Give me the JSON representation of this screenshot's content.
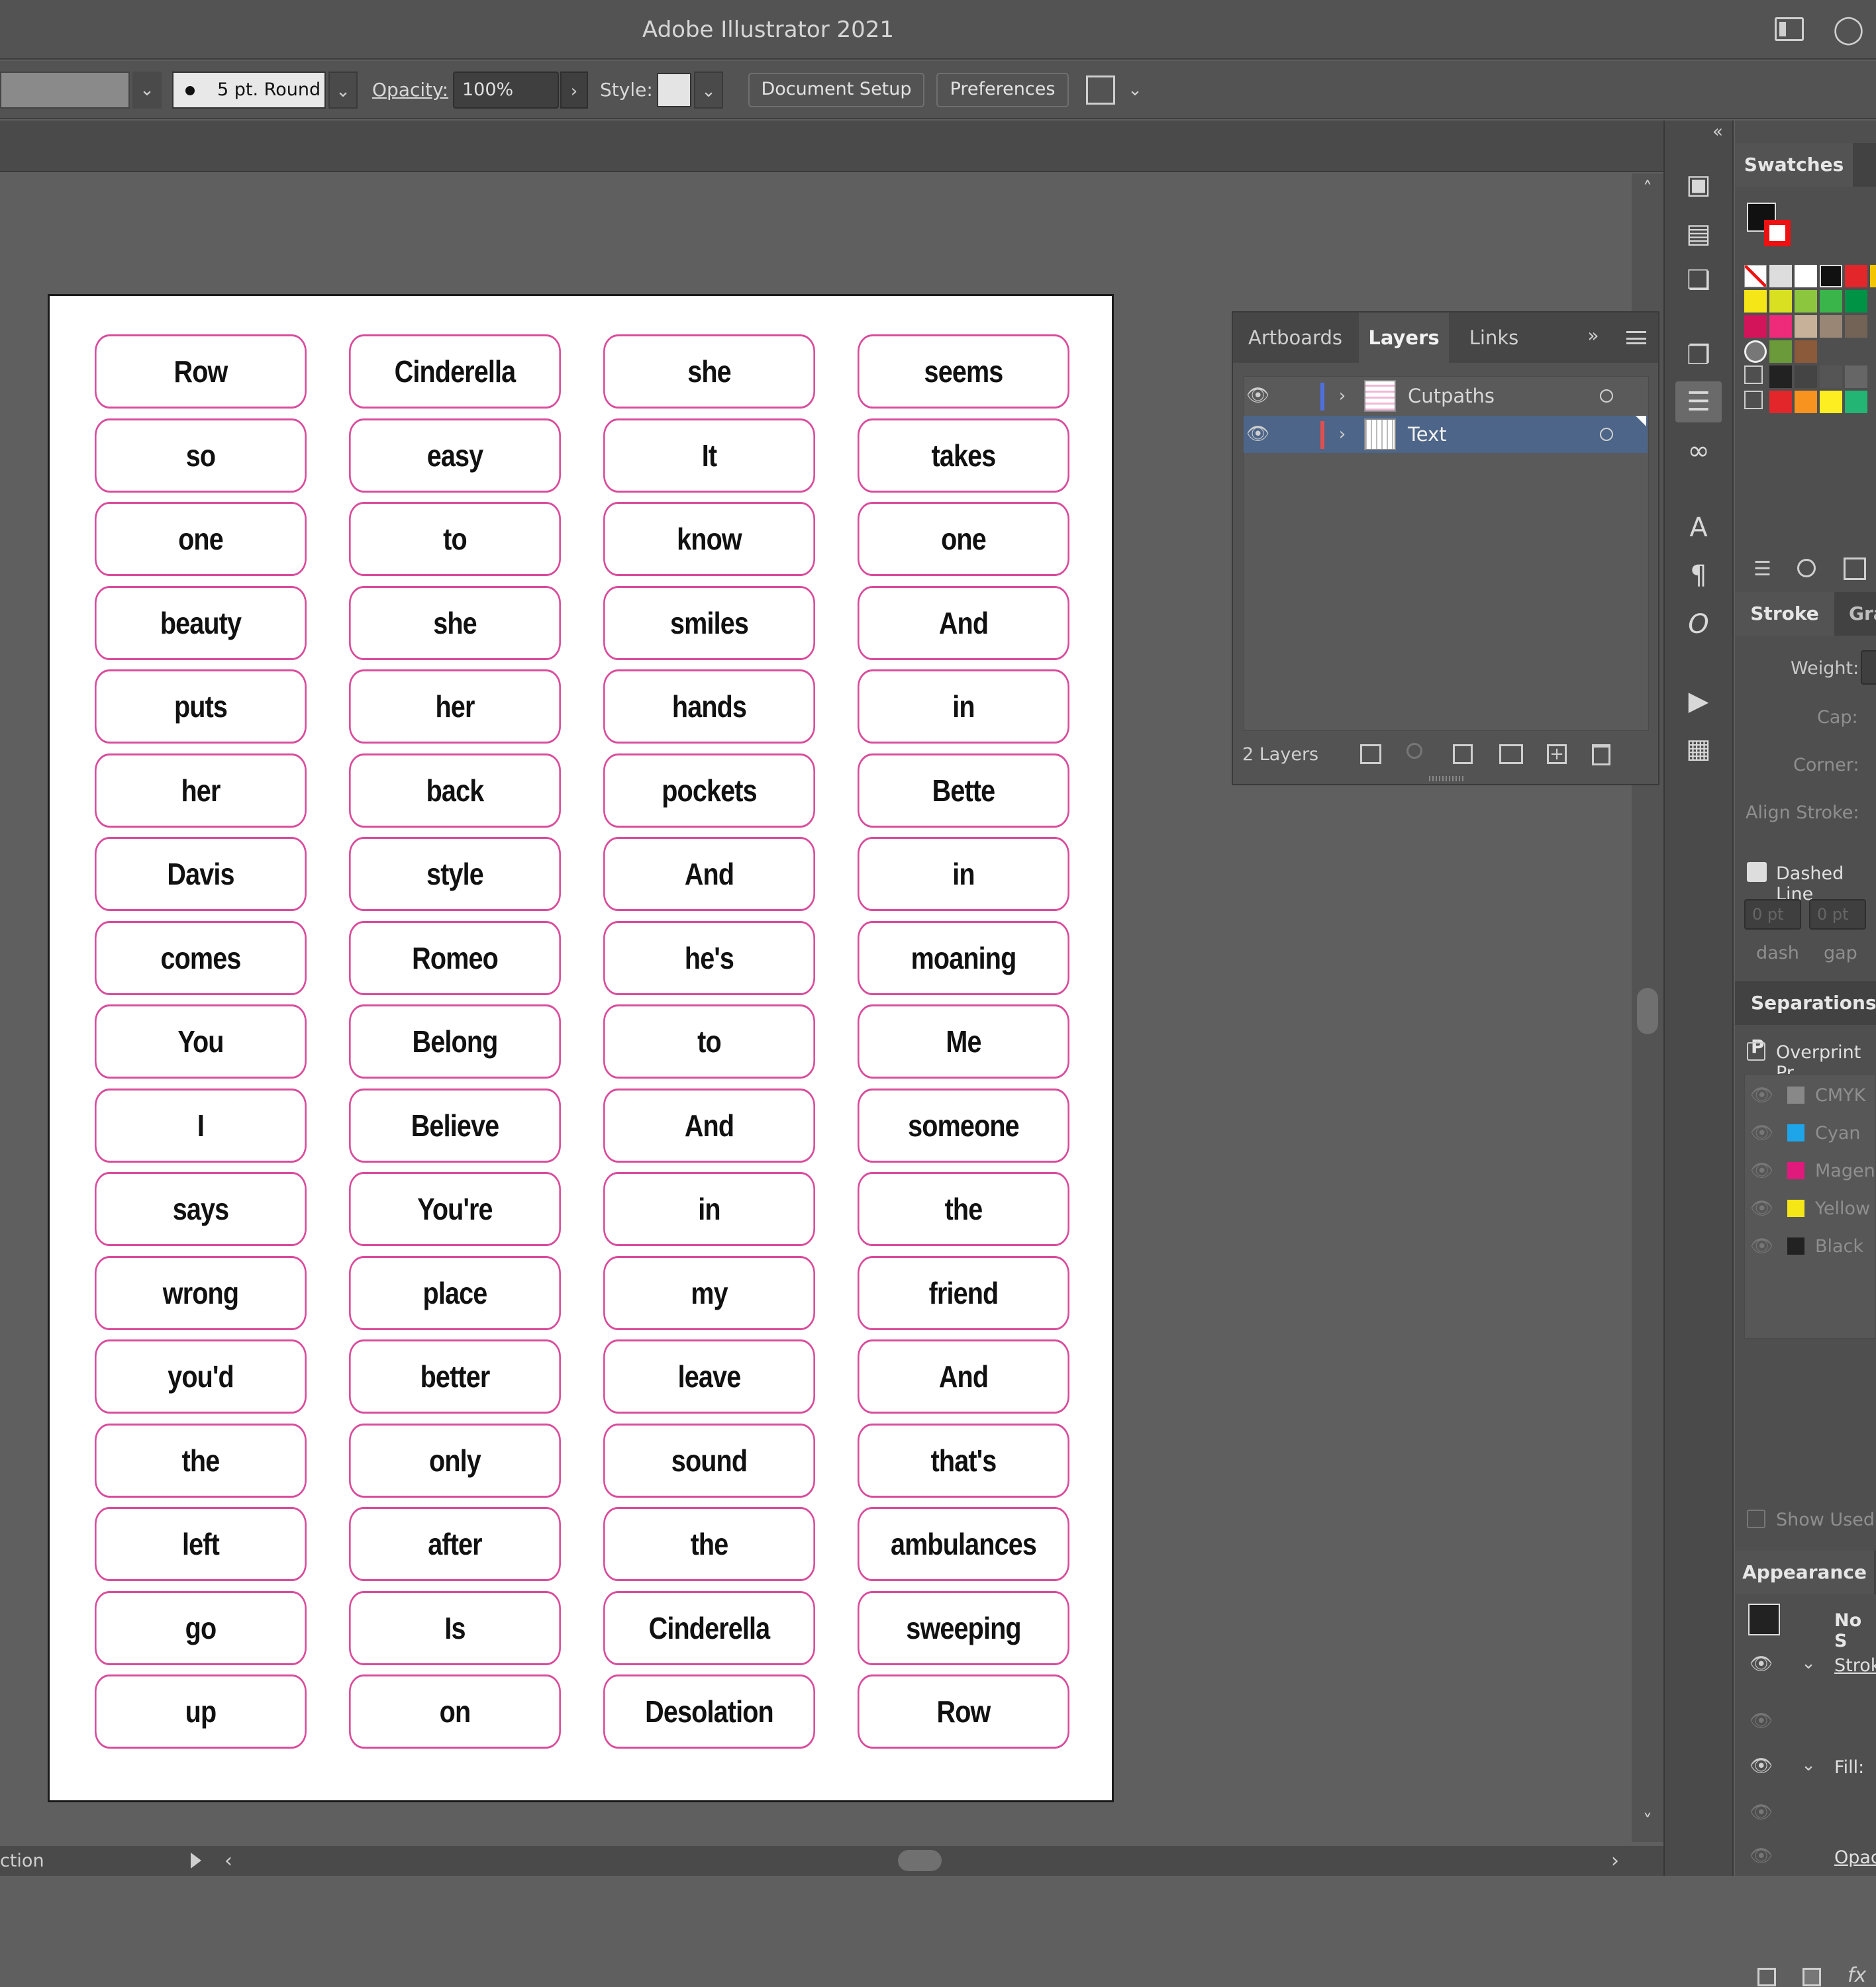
{
  "app": {
    "title": "Adobe Illustrator 2021"
  },
  "control_bar": {
    "stroke_profile": "5 pt. Round",
    "opacity_label": "Opacity:",
    "opacity_value": "100%",
    "style_label": "Style:",
    "document_setup": "Document Setup",
    "preferences": "Preferences"
  },
  "artboard": {
    "words": [
      [
        "Row",
        "Cinderella",
        "she",
        "seems"
      ],
      [
        "so",
        "easy",
        "It",
        "takes"
      ],
      [
        "one",
        "to",
        "know",
        "one"
      ],
      [
        "beauty",
        "she",
        "smiles",
        "And"
      ],
      [
        "puts",
        "her",
        "hands",
        "in"
      ],
      [
        "her",
        "back",
        "pockets",
        "Bette"
      ],
      [
        "Davis",
        "style",
        "And",
        "in"
      ],
      [
        "comes",
        "Romeo",
        "he's",
        "moaning"
      ],
      [
        "You",
        "Belong",
        "to",
        "Me"
      ],
      [
        "I",
        "Believe",
        "And",
        "someone"
      ],
      [
        "says",
        "You're",
        "in",
        "the"
      ],
      [
        "wrong",
        "place",
        "my",
        "friend"
      ],
      [
        "you'd",
        "better",
        "leave",
        "And"
      ],
      [
        "the",
        "only",
        "sound",
        "that's"
      ],
      [
        "left",
        "after",
        "the",
        "ambulances"
      ],
      [
        "go",
        "Is",
        "Cinderella",
        "sweeping"
      ],
      [
        "up",
        "on",
        "Desolation",
        "Row"
      ]
    ],
    "tile_stroke_color": "#d94c9c"
  },
  "layers_panel": {
    "tabs": [
      "Artboards",
      "Layers",
      "Links"
    ],
    "active_tab": "Layers",
    "layers": [
      {
        "name": "Cutpaths",
        "color": "#4f6fe0"
      },
      {
        "name": "Text",
        "color": "#e04f4f"
      }
    ],
    "count_label": "2 Layers"
  },
  "swatches_panel": {
    "tab": "Swatches"
  },
  "stroke_panel": {
    "tab": "Stroke",
    "tab2": "Gra",
    "weight_label": "Weight:",
    "cap_label": "Cap:",
    "corner_label": "Corner:",
    "align_label": "Align Stroke:",
    "dashed_label": "Dashed Line",
    "dash_value": "0 pt",
    "gap_value": "0 pt",
    "dash_label": "dash",
    "gap_label": "gap"
  },
  "separations_panel": {
    "title": "Separations P",
    "overprint_label": "Overprint Pr",
    "plates": [
      {
        "name": "CMYK",
        "color": "#888888"
      },
      {
        "name": "Cyan",
        "color": "#1ea4e8"
      },
      {
        "name": "Magen",
        "color": "#e0197d"
      },
      {
        "name": "Yellow",
        "color": "#f5e617"
      },
      {
        "name": "Black",
        "color": "#222222"
      }
    ],
    "show_used": "Show Used"
  },
  "appearance_panel": {
    "title": "Appearance",
    "selection": "No S",
    "stroke_label": "Strok",
    "fill_label": "Fill:",
    "opacity_label": "Opac"
  },
  "status_bar": {
    "tool": "ction"
  }
}
